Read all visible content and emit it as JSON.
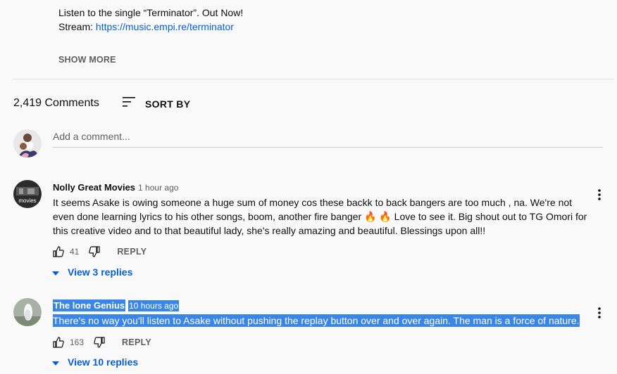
{
  "description": {
    "line1": "Listen to the single “Terminator”. Out Now!",
    "stream_label": "Stream: ",
    "stream_link": "https://music.empi.re/terminator",
    "show_more": "SHOW MORE"
  },
  "comments_header": {
    "count": "2,419 Comments",
    "sort_label": "SORT BY"
  },
  "add_comment": {
    "placeholder": "Add a comment..."
  },
  "comments": [
    {
      "author": "Nolly Great Movies",
      "time": "1 hour ago",
      "text": "It seems Asake is owing someone a huge sum of money cos these backk to back bangers are too much , na. We're not even done learning lyrics to his other songs, boom, another fire banger 🔥 🔥  Love to see it. Big shout out to TG Omori for this creative video and to that beautiful lady, she's really amazing and beautiful. Blessings upon all!!",
      "likes": "41",
      "reply": "REPLY",
      "view_replies": "View 3 replies",
      "avatar_text": "movies"
    },
    {
      "author": "The lone Genius",
      "time": "10 hours ago",
      "text": "There's no way you'll listen to Asake without pushing the replay button over and over again. The man is a force of nature.",
      "likes": "163",
      "reply": "REPLY",
      "view_replies": "View 10 replies"
    }
  ],
  "colors": {
    "link": "#065fd4",
    "highlight": "#3a86e6",
    "secondary_text": "#606060"
  }
}
